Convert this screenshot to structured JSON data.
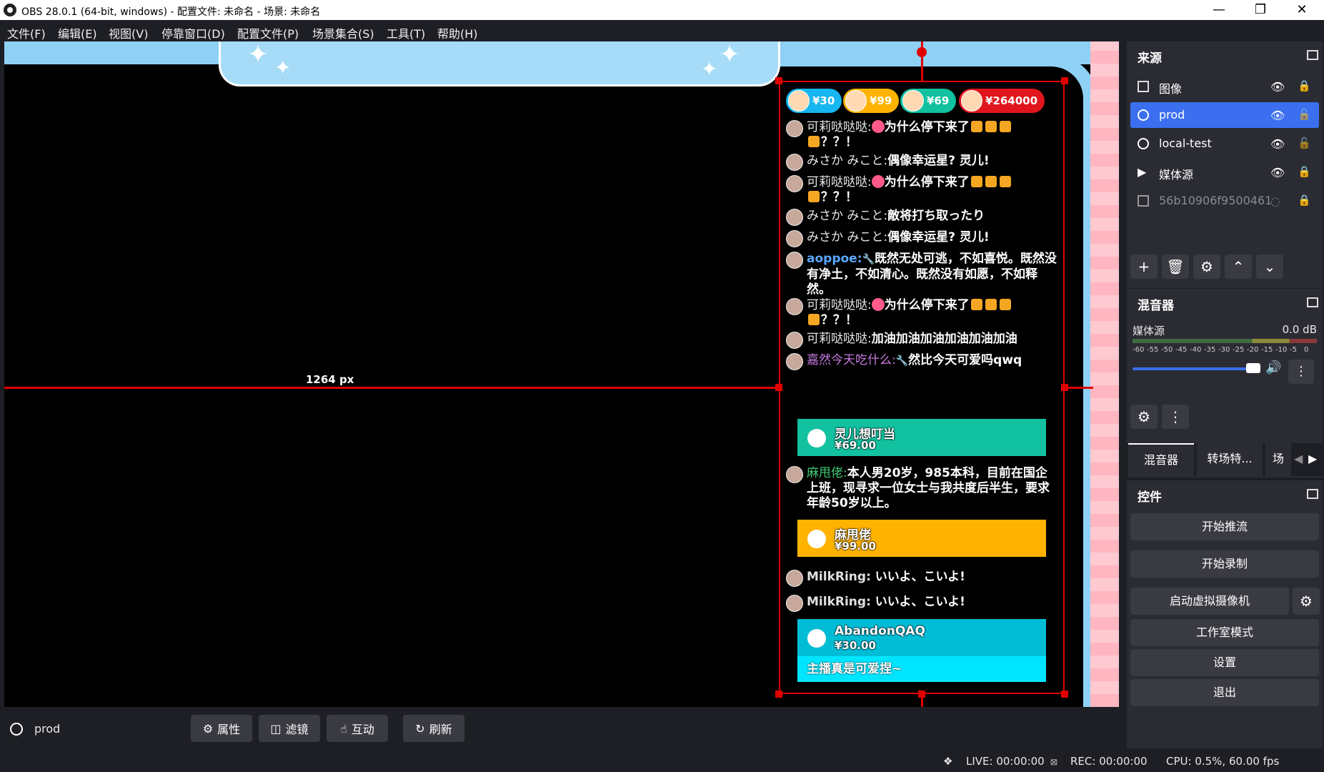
{
  "window": {
    "title": "OBS 28.0.1 (64-bit, windows) - 配置文件: 未命名 - 场景: 未命名"
  },
  "menu": [
    "文件(F)",
    "编辑(E)",
    "视图(V)",
    "停靠窗口(D)",
    "配置文件(P)",
    "场景集合(S)",
    "工具(T)",
    "帮助(H)"
  ],
  "preview": {
    "measure_label": "1264 px",
    "gifts": [
      "¥30",
      "¥99",
      "¥69",
      "¥264000"
    ],
    "gift_colors": [
      "#16b6f0",
      "#ffb300",
      "#12c1a0",
      "#e0161c"
    ],
    "messages": [
      {
        "user": "可莉哒哒哒:",
        "text": "为什么停下来了",
        "text2": "？？！",
        "style": "normal"
      },
      {
        "user": "みさか みこと:",
        "text": "偶像幸运星? 灵儿!",
        "style": "normal"
      },
      {
        "user": "可莉哒哒哒:",
        "text": "为什么停下来了",
        "text2": "？？！",
        "style": "normal"
      },
      {
        "user": "みさか みこと:",
        "text": "敵将打ち取ったり",
        "style": "normal"
      },
      {
        "user": "みさか みこと:",
        "text": "偶像幸运星? 灵儿!",
        "style": "normal"
      },
      {
        "user": "aoppoe:",
        "text": "既然无处可逃，不如喜悦。既然没有净土，不如清心。既然没有如愿，不如释然。",
        "style": "blue"
      },
      {
        "user": "可莉哒哒哒:",
        "text": "为什么停下来了",
        "text2": "？？！",
        "style": "normal"
      },
      {
        "user": "可莉哒哒哒:",
        "text": "加油加油加油加油加油加油",
        "style": "normal"
      },
      {
        "user": "嘉然今天吃什么:",
        "text": "然比今天可爱吗qwq",
        "style": "purple"
      }
    ],
    "sc1": {
      "name": "灵儿想叮当",
      "price": "¥69.00",
      "color": "#12c1a0"
    },
    "msg_after_sc1": {
      "user": "麻甩佬:",
      "text": "本人男20岁，985本科，目前在国企上班，现寻求一位女士与我共度后半生，要求年龄50岁以上。"
    },
    "sc2": {
      "name": "麻甩佬",
      "price": "¥99.00",
      "color": "#ffb300"
    },
    "milk_msgs": [
      {
        "user": "MilkRing:",
        "text": "いいよ、こいよ!"
      },
      {
        "user": "MilkRing:",
        "text": "いいよ、こいよ!"
      }
    ],
    "sc3": {
      "name": "AbandonQAQ",
      "price": "¥30.00",
      "text": "主播真是可爱捏~",
      "color": "#00bcd4"
    }
  },
  "source_toolbar": {
    "source_name": "prod",
    "buttons": [
      "属性",
      "滤镜",
      "互动",
      "刷新"
    ]
  },
  "status": {
    "live": "LIVE: 00:00:00",
    "rec": "REC: 00:00:00",
    "cpu": "CPU: 0.5%, 60.00 fps"
  },
  "sources": {
    "title": "来源",
    "items": [
      {
        "name": "图像",
        "icon": "image-icon",
        "visible": true,
        "selected": false
      },
      {
        "name": "prod",
        "icon": "globe-icon",
        "visible": true,
        "selected": true
      },
      {
        "name": "local-test",
        "icon": "globe-icon",
        "visible": true,
        "selected": false
      },
      {
        "name": "媒体源",
        "icon": "play-icon",
        "visible": true,
        "selected": false
      },
      {
        "name": "56b10906f9500461",
        "icon": "image-icon",
        "visible": false,
        "selected": false
      }
    ]
  },
  "mixer": {
    "title": "混音器",
    "channel": "媒体源",
    "level": "0.0 dB",
    "ticks": [
      "-60",
      "-55",
      "-50",
      "-45",
      "-40",
      "-35",
      "-30",
      "-25",
      "-20",
      "-15",
      "-10",
      "-5",
      "0"
    ],
    "volume_fraction": 0.95,
    "tabs": [
      "混音器",
      "转场特...",
      "场"
    ]
  },
  "controls": {
    "title": "控件",
    "buttons": [
      "开始推流",
      "开始录制",
      "启动虚拟摄像机",
      "工作室模式",
      "设置",
      "退出"
    ]
  }
}
